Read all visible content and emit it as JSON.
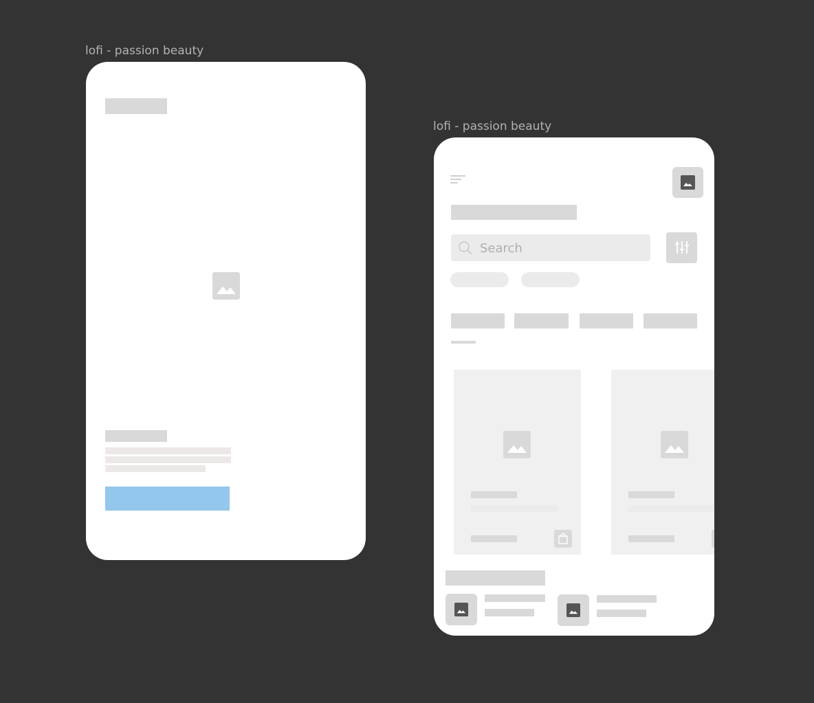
{
  "frames": [
    {
      "label": "lofi - passion beauty"
    },
    {
      "label": "lofi - passion beauty"
    }
  ],
  "home": {
    "search": {
      "placeholder": "Search"
    },
    "icons": {
      "menu": "menu-icon",
      "profile": "image-icon",
      "filter": "sliders-icon",
      "search": "search-icon",
      "cart": "shopping-bag-icon"
    }
  },
  "colors": {
    "background": "#333333",
    "frame": "#ffffff",
    "placeholder": "#d9d9d9",
    "cta": "#93c7ec"
  }
}
